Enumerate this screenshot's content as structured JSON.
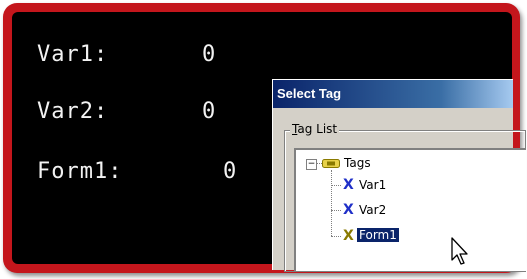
{
  "display": {
    "variables": [
      {
        "label": "Var1:",
        "value": "0"
      },
      {
        "label": "Var2:",
        "value": "0"
      },
      {
        "label": "Form1:",
        "value": "0"
      }
    ]
  },
  "dialog": {
    "title": "Select Tag",
    "group_label_mnemonic": "T",
    "group_label_rest": "ag List",
    "tree": {
      "root": {
        "label": "Tags",
        "expander": "−",
        "icon": "tags-folder-icon"
      },
      "children": [
        {
          "label": "Var1",
          "icon": "variable-x-icon",
          "icon_glyph": "X",
          "icon_color": "#1f2fc8"
        },
        {
          "label": "Var2",
          "icon": "variable-x-icon",
          "icon_glyph": "X",
          "icon_color": "#1f2fc8"
        },
        {
          "label": "Form1",
          "icon": "formula-x-icon",
          "icon_glyph": "X",
          "icon_color": "#8a7a00",
          "selected": true
        }
      ]
    }
  },
  "colors": {
    "frame": "#c4161c",
    "screen": "#000000",
    "titlebar_start": "#0a246a",
    "selection": "#0a246a"
  }
}
